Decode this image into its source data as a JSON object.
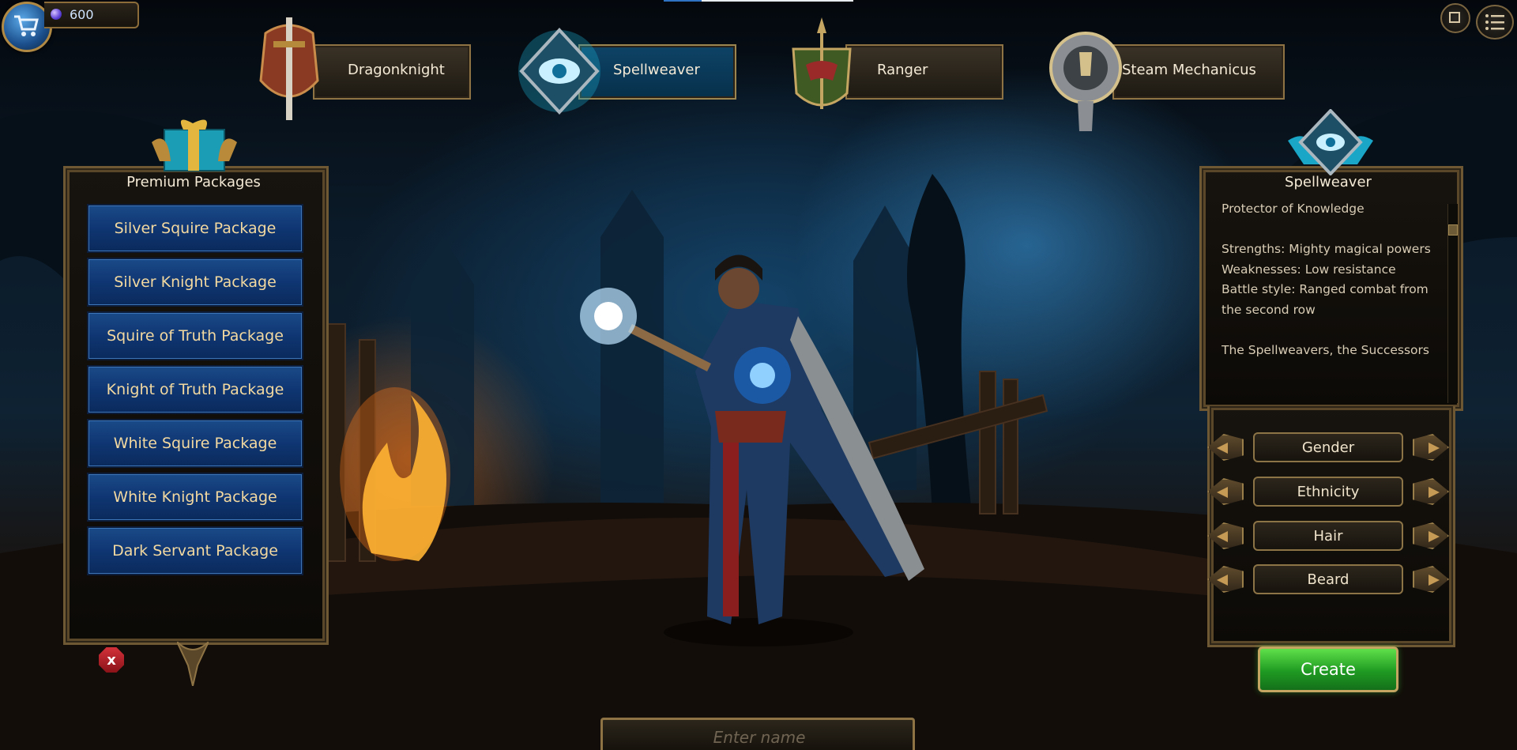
{
  "currency": {
    "value": "600",
    "gem_icon": "gem-icon",
    "cart_icon": "shopping-cart-icon"
  },
  "window": {
    "load_progress": 0.2
  },
  "classes": [
    {
      "label": "Dragonknight",
      "emblem": "sword-shield-emblem",
      "active": false
    },
    {
      "label": "Spellweaver",
      "emblem": "eye-rune-emblem",
      "active": true
    },
    {
      "label": "Ranger",
      "emblem": "bow-crest-emblem",
      "active": false
    },
    {
      "label": "Steam Mechanicus",
      "emblem": "gear-wrench-emblem",
      "active": false
    }
  ],
  "packages": {
    "title": "Premium Packages",
    "items": [
      "Silver Squire Package",
      "Silver Knight Package",
      "Squire of Truth Package",
      "Knight of Truth Package",
      "White Squire Package",
      "White Knight Package",
      "Dark Servant Package"
    ],
    "close_label": "x"
  },
  "class_info": {
    "title": "Spellweaver",
    "description": "Protector of Knowledge\n\nStrengths: Mighty magical powers\nWeaknesses: Low resistance\nBattle style: Ranged combat from the second row\n\nThe Spellweavers, the Successors"
  },
  "options": [
    {
      "label": "Gender"
    },
    {
      "label": "Ethnicity"
    },
    {
      "label": "Hair"
    },
    {
      "label": "Beard"
    }
  ],
  "create_label": "Create",
  "name_input": {
    "placeholder": "Enter name",
    "value": ""
  },
  "colors": {
    "accent_gold": "#8e7445",
    "package_blue": "#0f3672",
    "create_green": "#1f9a22"
  }
}
